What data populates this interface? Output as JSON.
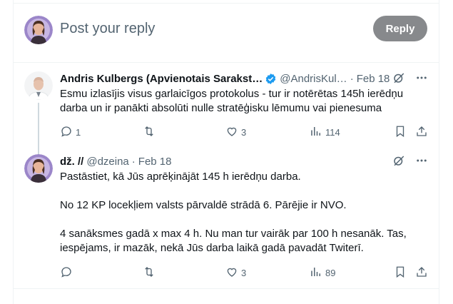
{
  "composer": {
    "placeholder": "Post your reply",
    "reply_label": "Reply"
  },
  "tweets": [
    {
      "name": "Andris Kulbergs (Apvienotais Sarakst…",
      "handle": "@AndrisKul…",
      "separator": "·",
      "date": "Feb 18",
      "verified": true,
      "body": [
        "Esmu izlasījis visus garlaicīgos protokolus - tur ir notērētas 145h ierēdņu darba un ir panākti absolūti nulle stratēģisku lēmumu vai pienesuma"
      ],
      "replies": "1",
      "reposts": "",
      "likes": "3",
      "views": "114"
    },
    {
      "name": "dž. //",
      "handle": "@dzeina",
      "separator": "·",
      "date": "Feb 18",
      "verified": false,
      "body": [
        "Pastāstiet, kā Jūs aprēķinājāt 145 h ierēdņu darba.",
        "No 12 KP locekļiem valsts pārvaldē strādā 6. Pārējie ir NVO.",
        "4 sanāksmes gadā x max 4 h. Nu man tur vairāk par 100 h nesanāk. Tas, iespējams, ir mazāk, nekā Jūs darba laikā gadā pavadāt Twiterī."
      ],
      "replies": "",
      "reposts": "",
      "likes": "3",
      "views": "89"
    }
  ],
  "colors": {
    "accent": "#1d9bf0",
    "muted": "#536471",
    "reply_button": "#87898c"
  },
  "icons": [
    "reply-icon",
    "repost-icon",
    "like-icon",
    "views-icon",
    "bookmark-icon",
    "share-icon",
    "grok-icon",
    "more-icon",
    "verified-icon"
  ]
}
